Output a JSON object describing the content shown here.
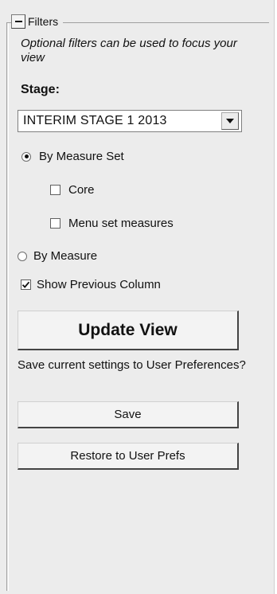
{
  "filters": {
    "title": "Filters",
    "collapse_icon": "minus-icon",
    "help_text": "Optional filters can be used to focus your view",
    "stage": {
      "label": "Stage:",
      "selected_value": "INTERIM STAGE 1 2013",
      "dropdown_icon": "chevron-down-icon"
    },
    "view_mode": {
      "by_measure_set": {
        "label": "By Measure Set",
        "selected": true,
        "sub_options": [
          {
            "label": "Core",
            "checked": false
          },
          {
            "label": "Menu set measures",
            "checked": false
          }
        ]
      },
      "by_measure": {
        "label": "By Measure",
        "selected": false
      }
    },
    "show_previous_column": {
      "label": "Show Previous Column",
      "checked": true
    },
    "update_button": "Update View",
    "save_prompt": "Save current settings to User Preferences?",
    "save_button": "Save",
    "restore_button": "Restore to User Prefs"
  }
}
